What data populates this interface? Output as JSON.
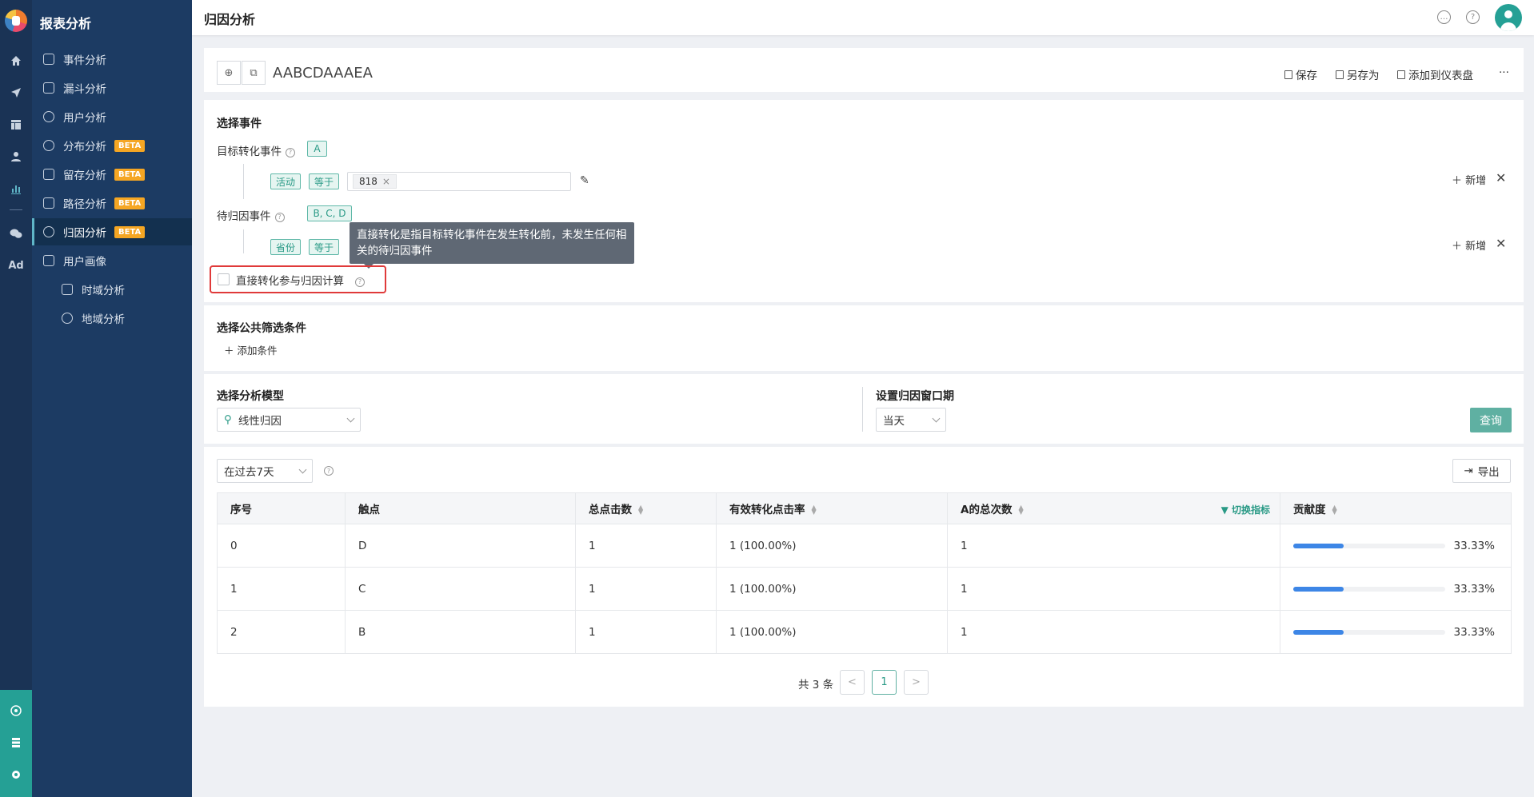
{
  "sidebar": {
    "title": "报表分析",
    "items": [
      {
        "label": "事件分析",
        "badge": ""
      },
      {
        "label": "漏斗分析",
        "badge": ""
      },
      {
        "label": "用户分析",
        "badge": ""
      },
      {
        "label": "分布分析",
        "badge": "BETA"
      },
      {
        "label": "留存分析",
        "badge": "BETA"
      },
      {
        "label": "路径分析",
        "badge": "BETA"
      },
      {
        "label": "归因分析",
        "badge": "BETA"
      },
      {
        "label": "用户画像",
        "badge": ""
      },
      {
        "label": "时域分析",
        "badge": ""
      },
      {
        "label": "地域分析",
        "badge": ""
      }
    ],
    "rail_ad": "Ad"
  },
  "header": {
    "title": "归因分析"
  },
  "query": {
    "name": "AABCDAAAEA",
    "actions": {
      "save": "保存",
      "save_as": "另存为",
      "add_dashboard": "添加到仪表盘",
      "more": "···"
    }
  },
  "events": {
    "section_title": "选择事件",
    "target_label": "目标转化事件",
    "target_tag": "A",
    "filter1": {
      "field": "活动",
      "op": "等于",
      "value": "818"
    },
    "pending_label": "待归因事件",
    "pending_tag": "B, C, D",
    "filter2": {
      "field": "省份",
      "op": "等于"
    },
    "add_new": "新增",
    "tooltip": "直接转化是指目标转化事件在发生转化前，未发生任何相关的待归因事件",
    "checkbox_label": "直接转化参与归因计算"
  },
  "filters": {
    "section_title": "选择公共筛选条件",
    "add": "添加条件"
  },
  "model": {
    "section_title": "选择分析模型",
    "value": "线性归因",
    "window_title": "设置归因窗口期",
    "window_value": "当天",
    "query_btn": "查询"
  },
  "result": {
    "range": "在过去7天",
    "export": "导出",
    "switch": "切换指标",
    "columns": [
      "序号",
      "触点",
      "总点击数",
      "有效转化点击率",
      "A的总次数",
      "贡献度"
    ],
    "rows": [
      {
        "idx": "0",
        "touch": "D",
        "clicks": "1",
        "rate": "1  (100.00%)",
        "total": "1",
        "pct": "33.33%",
        "frac": 0.3333
      },
      {
        "idx": "1",
        "touch": "C",
        "clicks": "1",
        "rate": "1  (100.00%)",
        "total": "1",
        "pct": "33.33%",
        "frac": 0.3333
      },
      {
        "idx": "2",
        "touch": "B",
        "clicks": "1",
        "rate": "1  (100.00%)",
        "total": "1",
        "pct": "33.33%",
        "frac": 0.3333
      }
    ],
    "pagination": {
      "total": "共 3 条",
      "page": "1",
      "prev": "<",
      "next": ">"
    }
  },
  "colors": {
    "accent": "#5fb0a2",
    "sidebar": "#1c3b63",
    "highlight": "#e03a3a",
    "bar": "#3d86e6"
  }
}
